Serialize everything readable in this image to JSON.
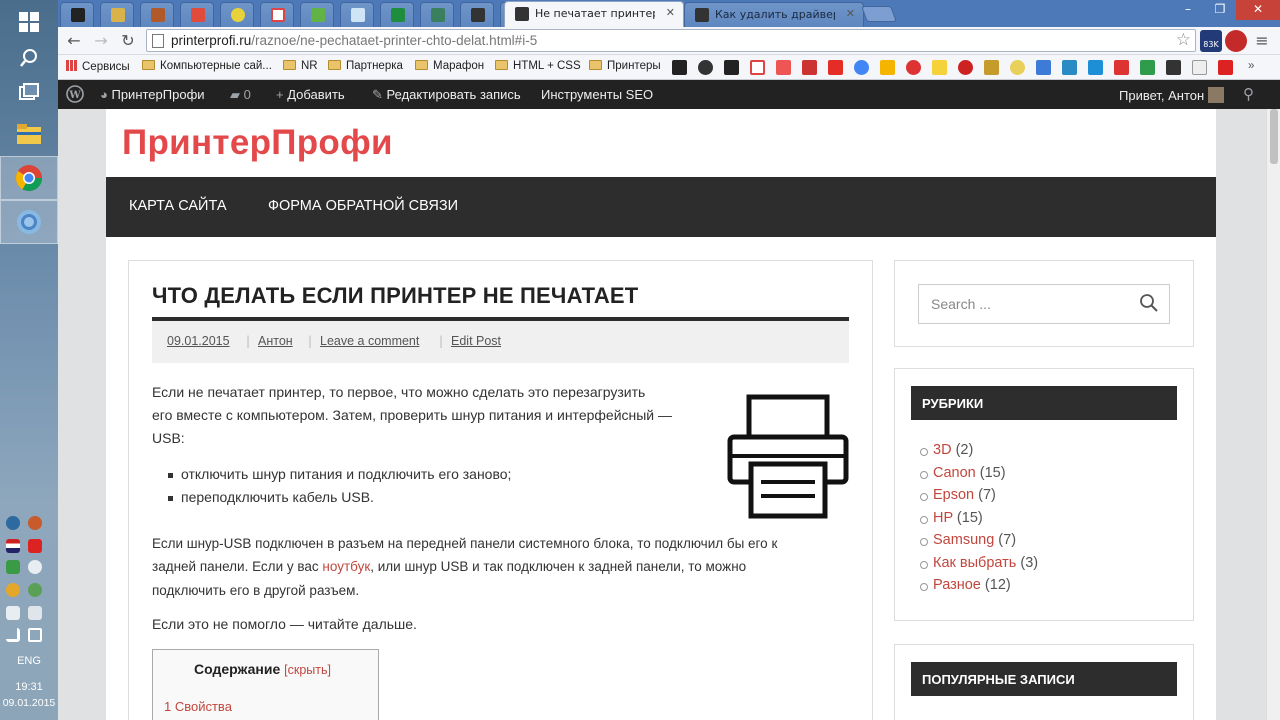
{
  "taskbar": {
    "lang": "ENG",
    "time": "19:31",
    "date": "09.01.2015"
  },
  "tabs": [
    {
      "title": "Не печатает принтер - что",
      "active": true
    },
    {
      "title": "Как удалить драйвер при",
      "active": false
    }
  ],
  "toolbar": {
    "url_host": "printerprofi.ru",
    "url_path": "/raznoe/ne-pechataet-printer-chto-delat.html#i-5",
    "ext_badge": "83K"
  },
  "bookmarks": [
    {
      "label": "Сервисы",
      "type": "apps"
    },
    {
      "label": "Компьютерные сай...",
      "type": "folder"
    },
    {
      "label": "NR",
      "type": "folder"
    },
    {
      "label": "Партнерка",
      "type": "folder"
    },
    {
      "label": "Марафон",
      "type": "folder"
    },
    {
      "label": "HTML + CSS",
      "type": "folder"
    },
    {
      "label": "Принтеры",
      "type": "folder"
    }
  ],
  "adminbar": {
    "site_name": "ПринтерПрофи",
    "comments": "0",
    "add": "Добавить",
    "edit": "Редактировать запись",
    "seo": "Инструменты SEO",
    "greeting": "Привет, Антон"
  },
  "site": {
    "logo": "ПринтерПрофи",
    "nav": [
      "КАРТА САЙТА",
      "ФОРМА ОБРАТНОЙ СВЯЗИ"
    ]
  },
  "post": {
    "title": "ЧТО ДЕЛАТЬ ЕСЛИ ПРИНТЕР НЕ ПЕЧАТАЕТ",
    "date": "09.01.2015",
    "author": "Антон",
    "comment_link": "Leave a comment",
    "edit_link": "Edit Post",
    "p1_lines": [
      "Если не печатает принтер, то первое, что можно сделать это перезагрузить",
      "его вместе с компьютером. Затем, проверить шнур питания и интерфейсный —",
      "USB:"
    ],
    "list": [
      "отключить шнур питания и подключить его заново;",
      "переподключить кабель USB."
    ],
    "p2_line1": "Если шнур-USB подключен в разъем на передней панели системного блока, то подключил бы его к",
    "p2_line2_a": "задней панели. Если у вас ",
    "p2_link": "ноутбук",
    "p2_line2_b": ", или шнур USB и так подключен к задней панели, то можно",
    "p2_line3": "подключить его в другой разъем.",
    "p3": "Если это не помогло — читайте дальше.",
    "toc_title": "Содержание",
    "toc_toggle": "[скрыть]",
    "toc_item": "1 Свойства"
  },
  "sidebar": {
    "search_placeholder": "Search ...",
    "cats_title": "РУБРИКИ",
    "categories": [
      {
        "name": "3D",
        "count": "(2)"
      },
      {
        "name": "Canon",
        "count": "(15)"
      },
      {
        "name": "Epson",
        "count": "(7)"
      },
      {
        "name": "HP",
        "count": "(15)"
      },
      {
        "name": "Samsung",
        "count": "(7)"
      },
      {
        "name": "Как выбрать",
        "count": "(3)"
      },
      {
        "name": "Разное",
        "count": "(12)"
      }
    ],
    "popular_title": "ПОПУЛЯРНЫЕ ЗАПИСИ"
  },
  "colors": {
    "accent": "#e3494a",
    "link": "#c1473e",
    "dark": "#2d2d2d"
  }
}
